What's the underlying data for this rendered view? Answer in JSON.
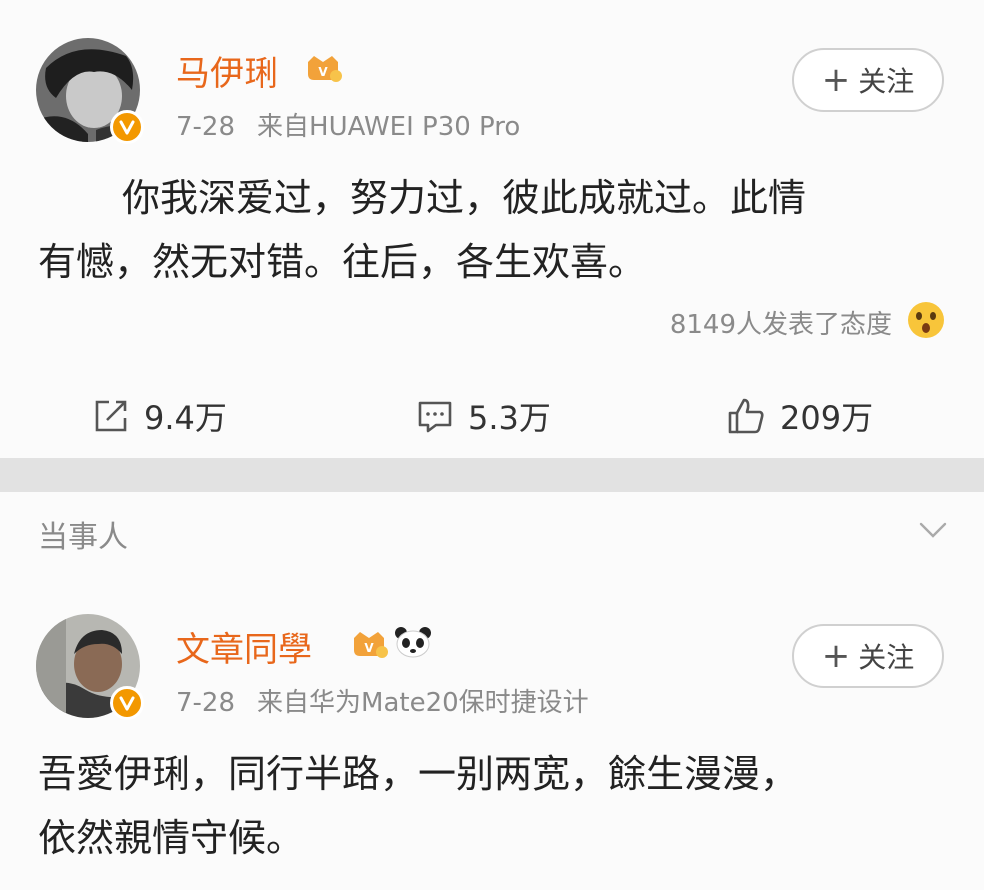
{
  "posts": [
    {
      "author": "马伊琍",
      "date": "7-28",
      "source": "来自HUAWEI P30 Pro",
      "follow_label": "关注",
      "text_line1": "你我深爱过，努力过，彼此成就过。此情",
      "text_line2": "有憾，然无对错。往后，各生欢喜。",
      "reactions_text": "8149人发表了态度",
      "reaction_icon": "surprised-face-icon",
      "actions": {
        "repost": {
          "icon": "repost-icon",
          "count": "9.4万"
        },
        "comment": {
          "icon": "comment-icon",
          "count": "5.3万"
        },
        "like": {
          "icon": "thumbs-up-icon",
          "count": "209万"
        }
      }
    },
    {
      "section_label": "当事人",
      "author": "文章同學",
      "date": "7-28",
      "source": "来自华为Mate20保时捷设计",
      "follow_label": "关注",
      "text_line1": "吾愛伊琍，同行半路，一别两宽，餘生漫漫，",
      "text_line2": "依然親情守候。"
    }
  ],
  "colors": {
    "name": "#e8671b",
    "verified_badge": "#f39800",
    "meta": "#8a8a8a",
    "background": "#fbfbfb",
    "divider": "#e2e2e2"
  }
}
